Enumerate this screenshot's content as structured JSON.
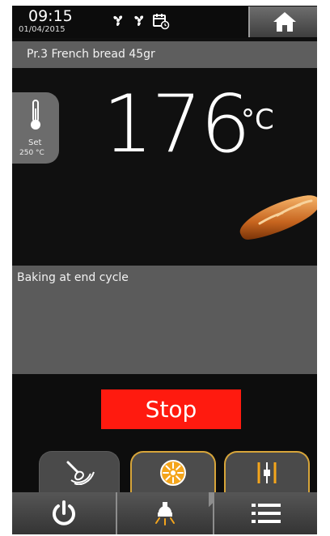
{
  "status_bar": {
    "time": "09:15",
    "date": "01/04/2015",
    "icons": [
      "fan-icon",
      "fan-icon",
      "calendar-timer-icon"
    ]
  },
  "home_button": {
    "icon": "home-icon"
  },
  "program": {
    "label": "Pr.3 French bread 45gr"
  },
  "temperature": {
    "set_label": "Set",
    "set_value": "250 °C",
    "current_value": "176",
    "unit": "°C"
  },
  "status": {
    "message": "Baking at end cycle"
  },
  "controls": {
    "stop_label": "Stop"
  },
  "tabs": [
    {
      "icon": "mixer-icon",
      "active": false
    },
    {
      "icon": "fan-speed-icon",
      "active": true
    },
    {
      "icon": "adjust-sliders-icon",
      "active": true
    }
  ],
  "bottom_nav": [
    {
      "icon": "power-icon"
    },
    {
      "icon": "oven-lamp-icon"
    },
    {
      "icon": "menu-list-icon"
    }
  ],
  "colors": {
    "accent": "#d7a53a",
    "stop": "#ff1a0f",
    "panel": "#5b5b5b"
  }
}
